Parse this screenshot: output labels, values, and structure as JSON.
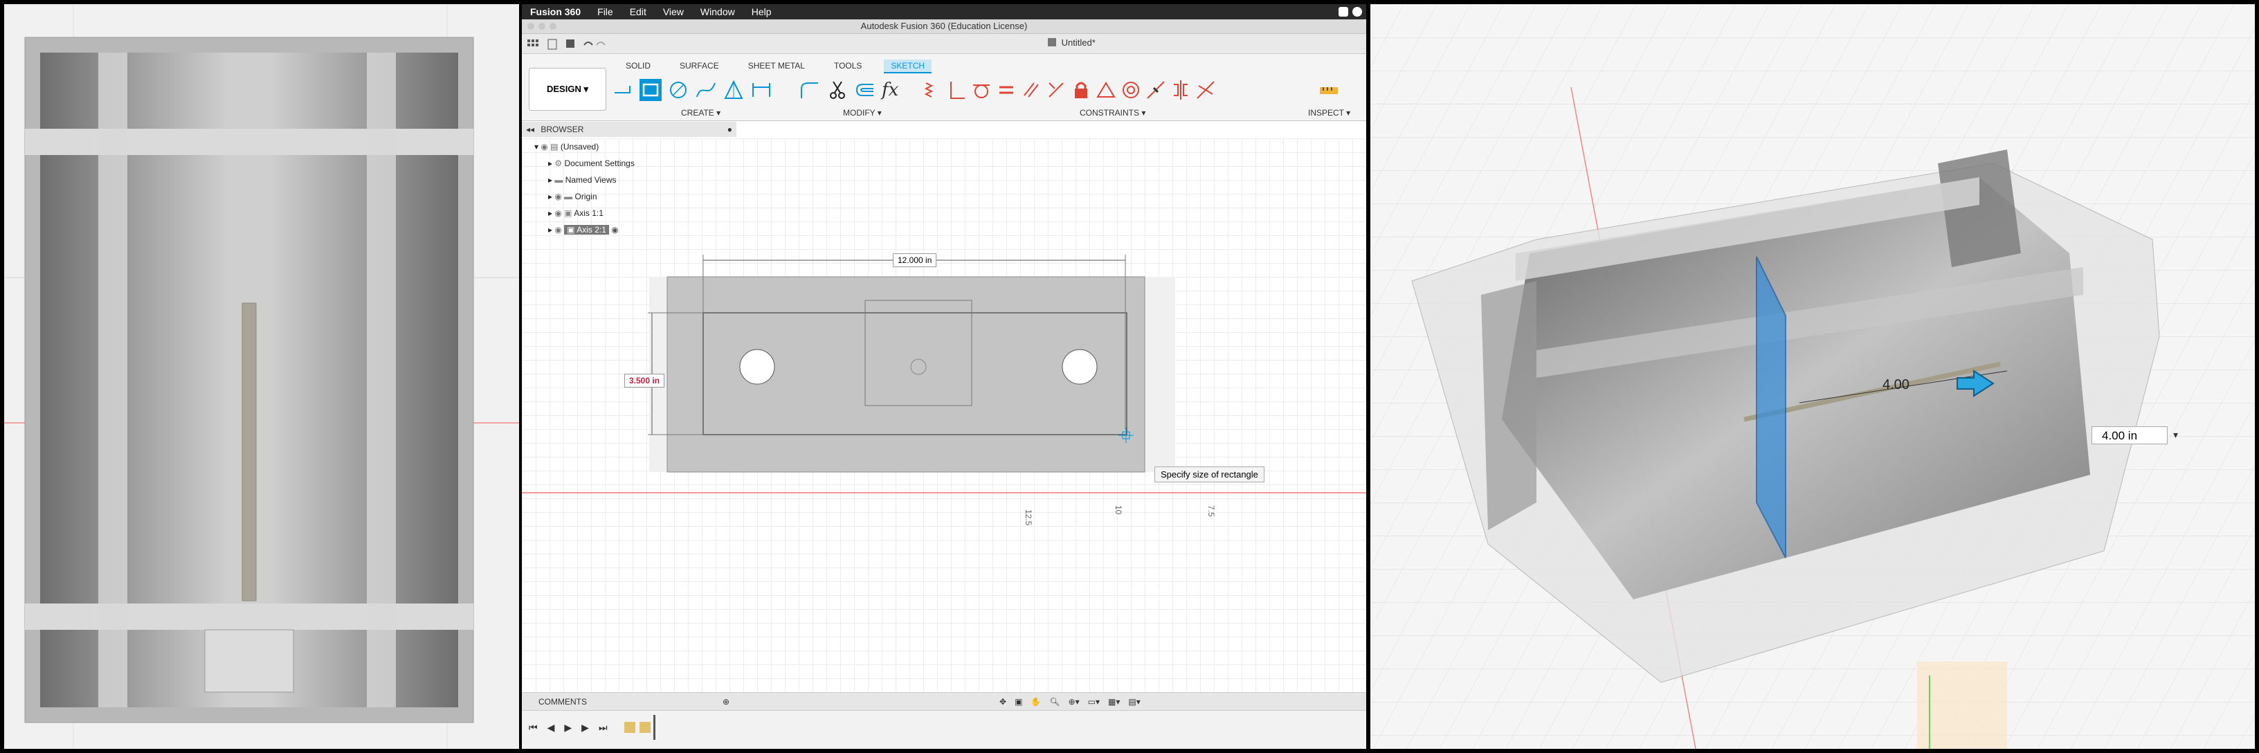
{
  "menubar": {
    "app": "Fusion 360",
    "items": [
      "File",
      "Edit",
      "View",
      "Window",
      "Help"
    ]
  },
  "window": {
    "title": "Autodesk Fusion 360 (Education License)",
    "document": "Untitled*"
  },
  "toolbar": {
    "workspace": "DESIGN",
    "tabs": [
      {
        "label": "SOLID",
        "active": false
      },
      {
        "label": "SURFACE",
        "active": false
      },
      {
        "label": "SHEET METAL",
        "active": false
      },
      {
        "label": "TOOLS",
        "active": false
      },
      {
        "label": "SKETCH",
        "active": true
      }
    ],
    "groups": {
      "create": "CREATE",
      "modify": "MODIFY",
      "constraints": "CONSTRAINTS",
      "inspect": "INSPECT"
    },
    "fx_label": "fx"
  },
  "browser": {
    "title": "BROWSER",
    "items": [
      {
        "label": "(Unsaved)",
        "icon": "document-icon"
      },
      {
        "label": "Document Settings",
        "icon": "gear-icon"
      },
      {
        "label": "Named Views",
        "icon": "folder-icon"
      },
      {
        "label": "Origin",
        "icon": "folder-icon"
      },
      {
        "label": "Axis 1:1",
        "icon": "component-icon"
      },
      {
        "label": "Axis 2:1",
        "icon": "component-icon",
        "active": true
      }
    ]
  },
  "sketch": {
    "width_dim": "12.000 in",
    "height_dim": "3.500 in",
    "tooltip": "Specify size of rectangle",
    "ruler_ticks": [
      "12.5",
      "10",
      "7.5"
    ]
  },
  "comments": {
    "title": "COMMENTS"
  },
  "right_view": {
    "dimension_label": "4.00",
    "value_input": "4.00 in"
  },
  "colors": {
    "accent": "#0696d7",
    "axis_red": "#e05050",
    "plane_blue": "#3a8fd8"
  }
}
